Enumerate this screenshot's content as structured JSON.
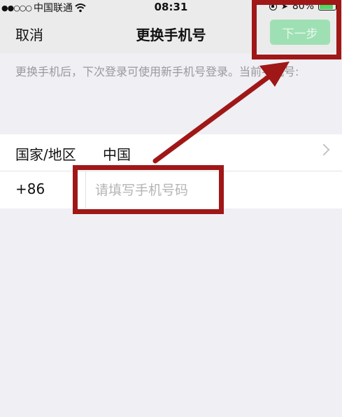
{
  "status_bar": {
    "signal": "●●○○○",
    "carrier": "中国联通",
    "time": "08:31",
    "battery": "80%",
    "battery_fill_fraction": 0.8
  },
  "nav": {
    "cancel_label": "取消",
    "title": "更换手机号",
    "next_label": "下一步"
  },
  "hint": "更换手机后，下次登录可使用新手机号登录。当前手机号:",
  "form": {
    "country_label": "国家/地区",
    "country_value": "中国",
    "country_code": "+86",
    "phone_placeholder": "请填写手机号码",
    "phone_value": ""
  },
  "colors": {
    "accent_green": "#9ee0b3",
    "annotation_red": "#a01717"
  }
}
